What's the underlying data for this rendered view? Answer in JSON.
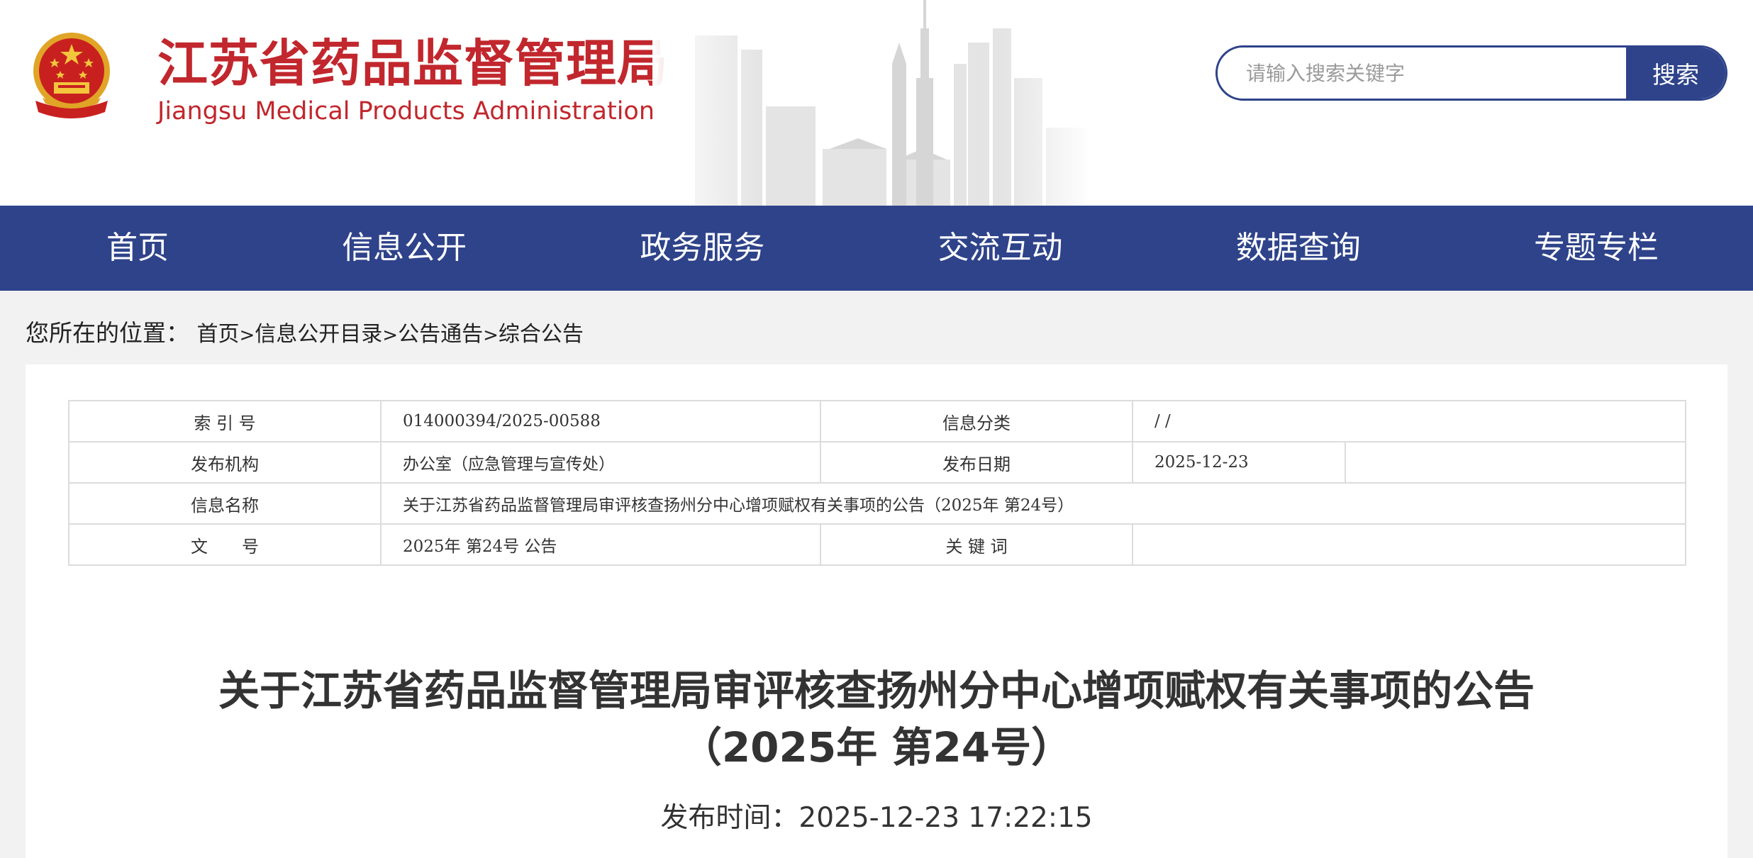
{
  "header": {
    "title_cn": "江苏省药品监督管理局",
    "title_en": "Jiangsu Medical Products Administration",
    "brand_color": "#c1272d",
    "search": {
      "placeholder": "请输入搜索关键字",
      "button_label": "搜索"
    }
  },
  "nav": {
    "background": "#2e438a",
    "items": [
      "首页",
      "信息公开",
      "政务服务",
      "交流互动",
      "数据查询",
      "专题专栏"
    ]
  },
  "breadcrumb": {
    "prefix": "您所在的位置：",
    "items": [
      "首页",
      "信息公开目录",
      "公告通告",
      "综合公告"
    ],
    "separator": ">"
  },
  "meta": {
    "index_label": "索 引 号",
    "index_value": "014000394/2025-00588",
    "category_label": "信息分类",
    "category_value": "/ /",
    "publisher_label": "发布机构",
    "publisher_value": "办公室（应急管理与宣传处）",
    "date_label": "发布日期",
    "date_value": "2025-12-23",
    "name_label": "信息名称",
    "name_value": "关于江苏省药品监督管理局审评核查扬州分中心增项赋权有关事项的公告（2025年 第24号）",
    "docno_label": "文　　号",
    "docno_value": "2025年 第24号 公告",
    "keywords_label": "关 键 词",
    "keywords_value": ""
  },
  "article": {
    "title_line1": "关于江苏省药品监督管理局审评核查扬州分中心增项赋权有关事项的公告",
    "title_line2": "（2025年 第24号）",
    "publish_label": "发布时间：",
    "publish_time": "2025-12-23 17:22:15"
  }
}
